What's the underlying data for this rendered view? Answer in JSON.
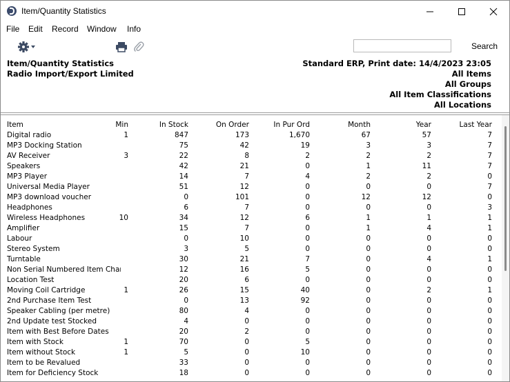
{
  "window": {
    "title": "Item/Quantity Statistics"
  },
  "menu": [
    "File",
    "Edit",
    "Record",
    "Window",
    "Info"
  ],
  "toolbar": {
    "search_value": "",
    "search_label": "Search"
  },
  "header": {
    "left": [
      "Item/Quantity Statistics",
      "Radio Import/Export Limited"
    ],
    "right": [
      "Standard ERP, Print date:  14/4/2023 23:05",
      "All Items",
      "All Groups",
      "All Item Classifications",
      "All Locations"
    ]
  },
  "columns": [
    "Item",
    "Min",
    "In Stock",
    "On Order",
    "In Pur Ord",
    "Month",
    "Year",
    "Last Year"
  ],
  "rows": [
    [
      "Digital radio",
      "1",
      "847",
      "173",
      "1,670",
      "67",
      "57",
      "7"
    ],
    [
      "MP3 Docking Station",
      "",
      "75",
      "42",
      "19",
      "3",
      "3",
      "7"
    ],
    [
      "AV Receiver",
      "3",
      "22",
      "8",
      "2",
      "2",
      "2",
      "7"
    ],
    [
      "Speakers",
      "",
      "42",
      "21",
      "0",
      "1",
      "11",
      "7"
    ],
    [
      "MP3 Player",
      "",
      "14",
      "7",
      "4",
      "2",
      "2",
      "0"
    ],
    [
      "Universal Media Player",
      "",
      "51",
      "12",
      "0",
      "0",
      "0",
      "7"
    ],
    [
      "MP3 download voucher",
      "",
      "0",
      "101",
      "0",
      "12",
      "12",
      "0"
    ],
    [
      "Headphones",
      "",
      "6",
      "7",
      "0",
      "0",
      "0",
      "3"
    ],
    [
      "Wireless Headphones",
      "10",
      "34",
      "12",
      "6",
      "1",
      "1",
      "1"
    ],
    [
      "Amplifier",
      "",
      "15",
      "7",
      "0",
      "1",
      "4",
      "1"
    ],
    [
      "Labour",
      "",
      "0",
      "10",
      "0",
      "0",
      "0",
      "0"
    ],
    [
      "Stereo System",
      "",
      "3",
      "5",
      "0",
      "0",
      "0",
      "0"
    ],
    [
      "Turntable",
      "",
      "30",
      "21",
      "7",
      "0",
      "4",
      "1"
    ],
    [
      "Non Serial Numbered Item Chang",
      "",
      "12",
      "16",
      "5",
      "0",
      "0",
      "0"
    ],
    [
      "Location Test",
      "",
      "20",
      "6",
      "0",
      "0",
      "0",
      "0"
    ],
    [
      "Moving Coil Cartridge",
      "1",
      "26",
      "15",
      "40",
      "0",
      "2",
      "1"
    ],
    [
      "2nd Purchase Item Test",
      "",
      "0",
      "13",
      "92",
      "0",
      "0",
      "0"
    ],
    [
      "Speaker Cabling (per metre)",
      "",
      "80",
      "4",
      "0",
      "0",
      "0",
      "0"
    ],
    [
      "2nd Update test Stocked",
      "",
      "4",
      "0",
      "0",
      "0",
      "0",
      "0"
    ],
    [
      "Item with Best Before Dates",
      "",
      "20",
      "2",
      "0",
      "0",
      "0",
      "0"
    ],
    [
      "Item with Stock",
      "1",
      "70",
      "0",
      "5",
      "0",
      "0",
      "0"
    ],
    [
      "Item without Stock",
      "1",
      "5",
      "0",
      "10",
      "0",
      "0",
      "0"
    ],
    [
      "Item to be Revalued",
      "",
      "33",
      "0",
      "0",
      "0",
      "0",
      "0"
    ],
    [
      "Item for Deficiency Stock",
      "",
      "18",
      "0",
      "0",
      "0",
      "0",
      "0"
    ]
  ]
}
